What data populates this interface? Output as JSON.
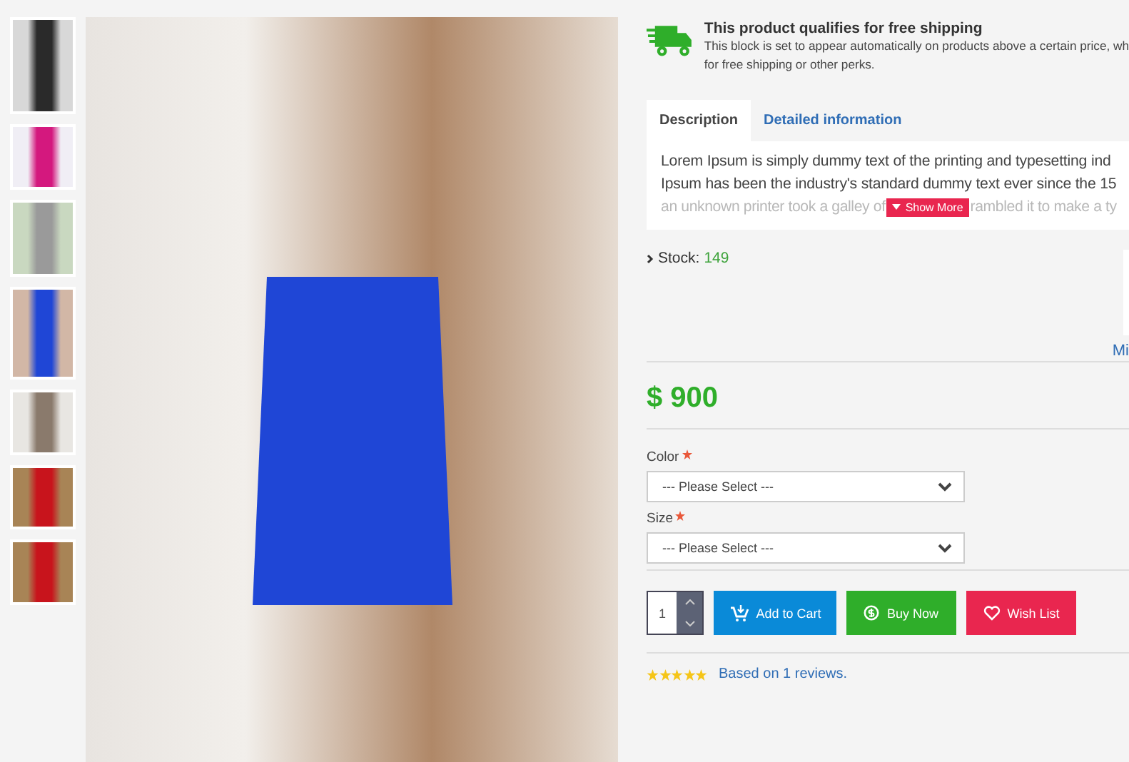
{
  "shipping": {
    "title": "This product qualifies for free shipping",
    "lines": [
      "This block is set to appear automatically on products above a certain price, wh",
      "for free shipping or other perks."
    ]
  },
  "tabs": [
    {
      "label": "Description",
      "selected": true
    },
    {
      "label": "Detailed information",
      "selected": false
    }
  ],
  "description": {
    "lines": [
      "Lorem Ipsum is simply dummy text of the printing and typesetting ind",
      "Ipsum has been the industry's standard dummy text ever since the 15"
    ],
    "faded_before": "an unknown printer took a galley of",
    "faded_after": "rambled it to make a ty",
    "show_more": "Show More"
  },
  "stock": {
    "label": "Stock:",
    "value": "149"
  },
  "side_link": "Mi",
  "price": "$ 900",
  "options": [
    {
      "label": "Color",
      "required": true,
      "placeholder": "--- Please Select ---"
    },
    {
      "label": "Size",
      "required": true,
      "placeholder": "--- Please Select ---"
    }
  ],
  "quantity": "1",
  "buttons": [
    {
      "kind": "cart",
      "label": "Add to Cart"
    },
    {
      "kind": "buy",
      "label": "Buy Now"
    },
    {
      "kind": "wish",
      "label": "Wish List"
    }
  ],
  "rating": {
    "stars": 5,
    "text": "Based on 1 reviews."
  }
}
